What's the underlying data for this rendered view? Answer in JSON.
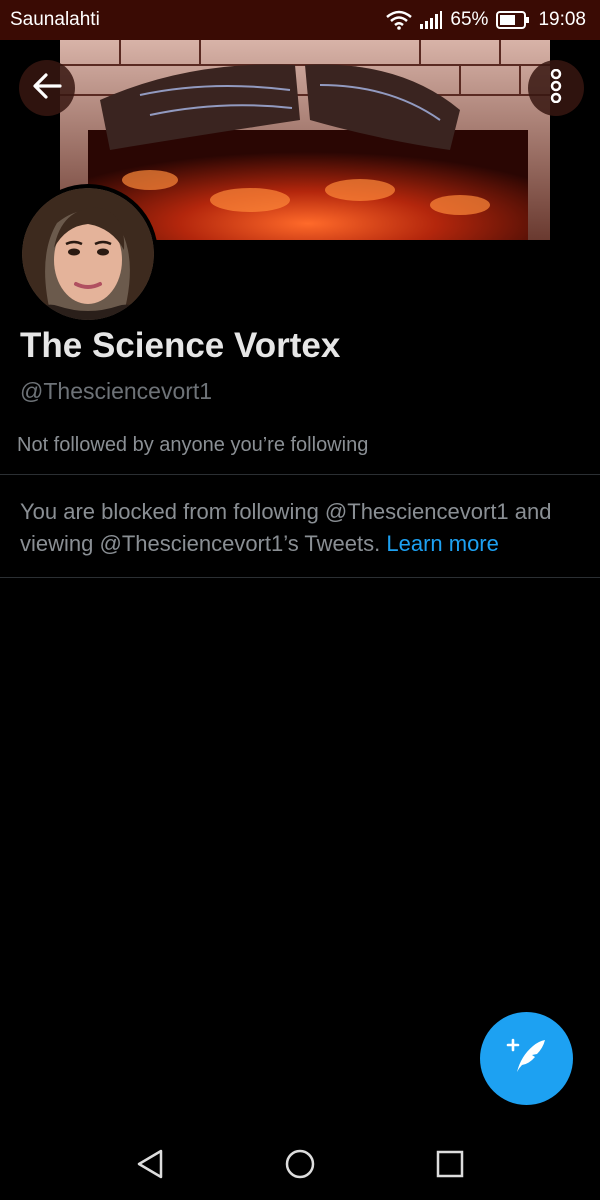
{
  "status_bar": {
    "carrier": "Saunalahti",
    "battery": "65%",
    "time": "19:08",
    "icons": [
      "wifi-icon",
      "signal-icon",
      "battery-icon"
    ]
  },
  "header": {
    "back_icon": "arrow-left-icon",
    "more_icon": "more-vertical-icon"
  },
  "profile": {
    "display_name": "The Science Vortex",
    "handle": "@Thesciencevort1",
    "followed_by": "Not followed by anyone you’re following"
  },
  "blocked": {
    "message": "You are blocked from following @Thesciencevort1 and viewing @Thesciencevort1’s Tweets. ",
    "learn_more": "Learn more"
  },
  "fab": {
    "icon": "compose-tweet-icon"
  },
  "nav": {
    "icons": [
      "nav-back-icon",
      "nav-home-icon",
      "nav-recents-icon"
    ]
  },
  "colors": {
    "status_bar_bg": "#3a0b04",
    "background": "#000000",
    "accent": "#1da1f2",
    "secondary_text": "#8a8f94"
  }
}
